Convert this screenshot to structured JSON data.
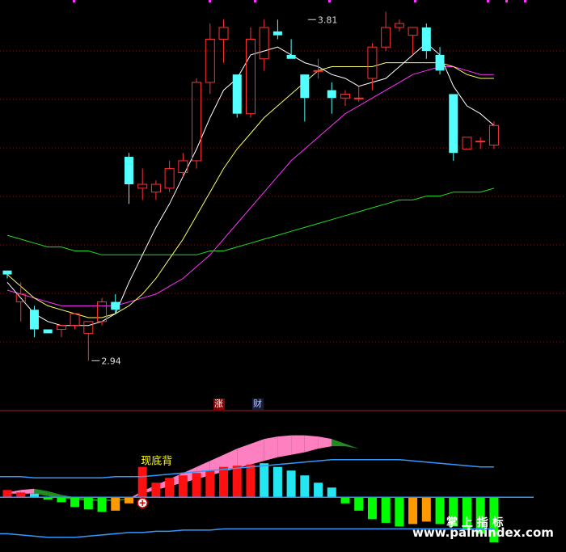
{
  "colors": {
    "background": "#000000",
    "grid": "#7a1515",
    "divider": "#a02020",
    "candle_up": "#ff3232",
    "candle_down": "#54ffff",
    "ma5": "#ffffff",
    "ma10": "#ffff66",
    "ma20": "#ff33ff",
    "ma60": "#22dd22",
    "bar_red": "#ff1010",
    "bar_cyan": "#22e6f0",
    "bar_green": "#00ff00",
    "bar_orange": "#ff9900",
    "band_pink": "#ff80c0",
    "band_green": "#228b22",
    "line_blue": "#3399ff",
    "annotation_yellow": "#ffff00",
    "marker_tag_bg": "#8b0000"
  },
  "markers": {
    "zhang": "涨",
    "cai": "财"
  },
  "watermark": "www.palmindex.com",
  "indicator_name": "掌 上 指 标",
  "chart_data": [
    {
      "type": "candlestick",
      "ylim": [
        2.85,
        3.86
      ],
      "annotations": [
        {
          "text": "3.81",
          "value": 3.81,
          "index": 22
        },
        {
          "text": "2.94",
          "value": 2.94,
          "index": 6
        }
      ],
      "candles": [
        {
          "o": 3.17,
          "h": 3.17,
          "l": 3.15,
          "c": 3.16
        },
        {
          "o": 3.09,
          "h": 3.14,
          "l": 3.04,
          "c": 3.11
        },
        {
          "o": 3.07,
          "h": 3.08,
          "l": 3.0,
          "c": 3.02
        },
        {
          "o": 3.02,
          "h": 3.02,
          "l": 3.01,
          "c": 3.01
        },
        {
          "o": 3.02,
          "h": 3.03,
          "l": 3.0,
          "c": 3.03
        },
        {
          "o": 3.03,
          "h": 3.06,
          "l": 3.02,
          "c": 3.06
        },
        {
          "o": 3.01,
          "h": 3.04,
          "l": 2.94,
          "c": 3.04
        },
        {
          "o": 3.04,
          "h": 3.1,
          "l": 3.03,
          "c": 3.09
        },
        {
          "o": 3.09,
          "h": 3.11,
          "l": 3.06,
          "c": 3.07
        },
        {
          "o": 3.46,
          "h": 3.47,
          "l": 3.34,
          "c": 3.39
        },
        {
          "o": 3.38,
          "h": 3.43,
          "l": 3.35,
          "c": 3.39
        },
        {
          "o": 3.37,
          "h": 3.4,
          "l": 3.35,
          "c": 3.39
        },
        {
          "o": 3.38,
          "h": 3.45,
          "l": 3.37,
          "c": 3.43
        },
        {
          "o": 3.42,
          "h": 3.47,
          "l": 3.41,
          "c": 3.45
        },
        {
          "o": 3.45,
          "h": 3.66,
          "l": 3.43,
          "c": 3.65
        },
        {
          "o": 3.65,
          "h": 3.8,
          "l": 3.62,
          "c": 3.76
        },
        {
          "o": 3.76,
          "h": 3.81,
          "l": 3.7,
          "c": 3.79
        },
        {
          "o": 3.67,
          "h": 3.67,
          "l": 3.56,
          "c": 3.57
        },
        {
          "o": 3.57,
          "h": 3.79,
          "l": 3.56,
          "c": 3.76
        },
        {
          "o": 3.71,
          "h": 3.81,
          "l": 3.68,
          "c": 3.79
        },
        {
          "o": 3.78,
          "h": 3.81,
          "l": 3.76,
          "c": 3.77
        },
        {
          "o": 3.72,
          "h": 3.76,
          "l": 3.71,
          "c": 3.71
        },
        {
          "o": 3.67,
          "h": 3.67,
          "l": 3.55,
          "c": 3.61
        },
        {
          "o": 3.68,
          "h": 3.71,
          "l": 3.66,
          "c": 3.68
        },
        {
          "o": 3.63,
          "h": 3.65,
          "l": 3.57,
          "c": 3.61
        },
        {
          "o": 3.61,
          "h": 3.63,
          "l": 3.59,
          "c": 3.62
        },
        {
          "o": 3.61,
          "h": 3.64,
          "l": 3.6,
          "c": 3.61
        },
        {
          "o": 3.66,
          "h": 3.75,
          "l": 3.63,
          "c": 3.74
        },
        {
          "o": 3.74,
          "h": 3.83,
          "l": 3.73,
          "c": 3.79
        },
        {
          "o": 3.79,
          "h": 3.81,
          "l": 3.78,
          "c": 3.8
        },
        {
          "o": 3.77,
          "h": 3.79,
          "l": 3.72,
          "c": 3.79
        },
        {
          "o": 3.79,
          "h": 3.8,
          "l": 3.71,
          "c": 3.73
        },
        {
          "o": 3.72,
          "h": 3.74,
          "l": 3.67,
          "c": 3.68
        },
        {
          "o": 3.62,
          "h": 3.62,
          "l": 3.45,
          "c": 3.47
        },
        {
          "o": 3.48,
          "h": 3.51,
          "l": 3.48,
          "c": 3.51
        },
        {
          "o": 3.5,
          "h": 3.51,
          "l": 3.48,
          "c": 3.5
        },
        {
          "o": 3.49,
          "h": 3.55,
          "l": 3.48,
          "c": 3.54
        }
      ],
      "ma5": [
        3.14,
        3.1,
        3.06,
        3.04,
        3.03,
        3.03,
        3.03,
        3.04,
        3.06,
        3.14,
        3.21,
        3.28,
        3.34,
        3.41,
        3.48,
        3.56,
        3.63,
        3.66,
        3.72,
        3.73,
        3.74,
        3.72,
        3.7,
        3.69,
        3.67,
        3.66,
        3.64,
        3.65,
        3.66,
        3.69,
        3.72,
        3.75,
        3.72,
        3.64,
        3.59,
        3.57,
        3.54
      ],
      "ma10": [
        3.16,
        3.13,
        3.1,
        3.08,
        3.07,
        3.06,
        3.05,
        3.05,
        3.06,
        3.08,
        3.11,
        3.15,
        3.2,
        3.25,
        3.31,
        3.37,
        3.43,
        3.48,
        3.52,
        3.56,
        3.59,
        3.62,
        3.65,
        3.68,
        3.69,
        3.69,
        3.69,
        3.69,
        3.7,
        3.7,
        3.7,
        3.7,
        3.7,
        3.69,
        3.67,
        3.66,
        3.66
      ],
      "ma20": [
        3.12,
        3.11,
        3.1,
        3.09,
        3.08,
        3.08,
        3.08,
        3.08,
        3.08,
        3.09,
        3.1,
        3.11,
        3.13,
        3.15,
        3.18,
        3.21,
        3.25,
        3.29,
        3.33,
        3.37,
        3.41,
        3.45,
        3.48,
        3.51,
        3.54,
        3.57,
        3.59,
        3.61,
        3.63,
        3.65,
        3.67,
        3.68,
        3.69,
        3.69,
        3.68,
        3.67,
        3.67
      ],
      "ma60": [
        3.26,
        3.25,
        3.24,
        3.23,
        3.23,
        3.22,
        3.22,
        3.21,
        3.21,
        3.21,
        3.21,
        3.21,
        3.21,
        3.21,
        3.21,
        3.22,
        3.22,
        3.23,
        3.24,
        3.25,
        3.26,
        3.27,
        3.28,
        3.29,
        3.3,
        3.31,
        3.32,
        3.33,
        3.34,
        3.35,
        3.35,
        3.36,
        3.36,
        3.37,
        3.37,
        3.37,
        3.38
      ]
    },
    {
      "type": "bar",
      "ylim": [
        -45,
        70
      ],
      "annotation": {
        "text": "现底背",
        "index": 10
      },
      "bars": [
        {
          "v": 6,
          "c": "red"
        },
        {
          "v": 4,
          "c": "red"
        },
        {
          "v": 3,
          "c": "cyan"
        },
        {
          "v": -2,
          "c": "green"
        },
        {
          "v": -4,
          "c": "green"
        },
        {
          "v": -8,
          "c": "green"
        },
        {
          "v": -10,
          "c": "green"
        },
        {
          "v": -12,
          "c": "green"
        },
        {
          "v": -11,
          "c": "orange"
        },
        {
          "v": -5,
          "c": "orange"
        },
        {
          "v": 25,
          "c": "red"
        },
        {
          "v": 12,
          "c": "red"
        },
        {
          "v": 16,
          "c": "red"
        },
        {
          "v": 18,
          "c": "red"
        },
        {
          "v": 20,
          "c": "red"
        },
        {
          "v": 22,
          "c": "red"
        },
        {
          "v": 25,
          "c": "red"
        },
        {
          "v": 26,
          "c": "red"
        },
        {
          "v": 27,
          "c": "red"
        },
        {
          "v": 28,
          "c": "cyan"
        },
        {
          "v": 25,
          "c": "cyan"
        },
        {
          "v": 22,
          "c": "cyan"
        },
        {
          "v": 18,
          "c": "cyan"
        },
        {
          "v": 12,
          "c": "cyan"
        },
        {
          "v": 8,
          "c": "cyan"
        },
        {
          "v": -5,
          "c": "green"
        },
        {
          "v": -11,
          "c": "green"
        },
        {
          "v": -18,
          "c": "green"
        },
        {
          "v": -21,
          "c": "green"
        },
        {
          "v": -24,
          "c": "green"
        },
        {
          "v": -22,
          "c": "orange"
        },
        {
          "v": -20,
          "c": "orange"
        },
        {
          "v": -22,
          "c": "green"
        },
        {
          "v": -24,
          "c": "green"
        },
        {
          "v": -27,
          "c": "green"
        },
        {
          "v": -30,
          "c": "green"
        },
        {
          "v": -37,
          "c": "green"
        }
      ],
      "band_upper": [
        4,
        6,
        7,
        5,
        2,
        0,
        -1,
        -2,
        -2,
        -1,
        5,
        10,
        15,
        20,
        25,
        30,
        35,
        40,
        44,
        48,
        50,
        51,
        51,
        50,
        48,
        44,
        40,
        37,
        33,
        29,
        26,
        22,
        18,
        14,
        11,
        7,
        3
      ],
      "band_lower": [
        3,
        3,
        3,
        1,
        -1,
        -2,
        -3,
        -3,
        -3,
        -2,
        3,
        6,
        9,
        12,
        15,
        18,
        21,
        24,
        27,
        30,
        33,
        35,
        37,
        40,
        42,
        42,
        40,
        37,
        33,
        29,
        26,
        22,
        18,
        14,
        11,
        7,
        3
      ],
      "band_colors": [
        "pink",
        "pink",
        "pink",
        "green",
        "green",
        "green",
        "green",
        "green",
        "green",
        "green",
        "pink",
        "pink",
        "pink",
        "pink",
        "pink",
        "pink",
        "pink",
        "pink",
        "pink",
        "pink",
        "pink",
        "pink",
        "pink",
        "pink",
        "pink",
        "green",
        "green",
        "green",
        "green",
        "green",
        "green",
        "green",
        "green",
        "green",
        "green",
        "green",
        "green"
      ],
      "upper_line": [
        17,
        17,
        16,
        16,
        16,
        16,
        16,
        16,
        17,
        17,
        17,
        18,
        19,
        20,
        21,
        22,
        23,
        24,
        25,
        26,
        27,
        28,
        29,
        30,
        31,
        31,
        31,
        31,
        31,
        31,
        30,
        29,
        28,
        27,
        26,
        25,
        25
      ],
      "lower_line": [
        -30,
        -31,
        -32,
        -33,
        -33,
        -33,
        -32,
        -31,
        -30,
        -29,
        -29,
        -28,
        -28,
        -27,
        -27,
        -27,
        -26,
        -26,
        -26,
        -26,
        -26,
        -26,
        -26,
        -26,
        -26,
        -26,
        -26,
        -26,
        -26,
        -26,
        -26,
        -26,
        -26,
        -26,
        -26,
        -26,
        -26
      ]
    }
  ]
}
